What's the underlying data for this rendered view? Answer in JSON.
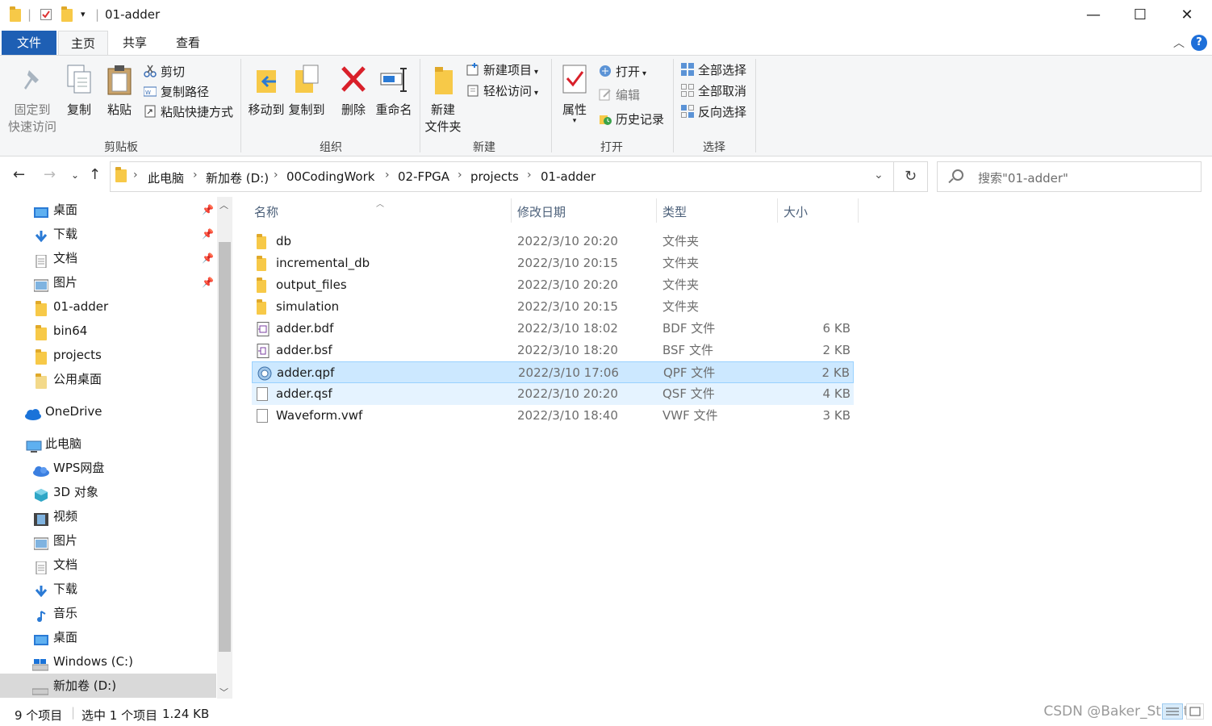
{
  "window": {
    "title": "01-adder",
    "minimize": "—",
    "maximize": "☐",
    "close": "✕"
  },
  "tabs": {
    "file": "文件",
    "home": "主页",
    "share": "共享",
    "view": "查看"
  },
  "ribbon": {
    "clipboard": {
      "group": "剪贴板",
      "pin_line1": "固定到",
      "pin_line2": "快速访问",
      "copy": "复制",
      "paste": "粘贴",
      "cut": "剪切",
      "copy_path": "复制路径",
      "paste_shortcut": "粘贴快捷方式"
    },
    "organize": {
      "group": "组织",
      "move_to": "移动到",
      "copy_to": "复制到",
      "delete": "删除",
      "rename": "重命名"
    },
    "new": {
      "group": "新建",
      "new_folder_line1": "新建",
      "new_folder_line2": "文件夹",
      "new_item": "新建项目",
      "easy_access": "轻松访问"
    },
    "open": {
      "group": "打开",
      "properties": "属性",
      "open": "打开",
      "edit": "编辑",
      "history": "历史记录"
    },
    "select": {
      "group": "选择",
      "select_all": "全部选择",
      "select_none": "全部取消",
      "invert": "反向选择"
    }
  },
  "address": {
    "crumbs": [
      "此电脑",
      "新加卷 (D:)",
      "00CodingWork",
      "02-FPGA",
      "projects",
      "01-adder"
    ],
    "search_placeholder": "搜索\"01-adder\""
  },
  "nav": {
    "items": [
      {
        "label": "桌面",
        "icon": "desktop-icon",
        "pinned": true
      },
      {
        "label": "下载",
        "icon": "download-icon",
        "pinned": true
      },
      {
        "label": "文档",
        "icon": "document-icon",
        "pinned": true
      },
      {
        "label": "图片",
        "icon": "picture-icon",
        "pinned": true
      },
      {
        "label": "01-adder",
        "icon": "folder-icon"
      },
      {
        "label": "bin64",
        "icon": "folder-icon"
      },
      {
        "label": "projects",
        "icon": "folder-icon"
      },
      {
        "label": "公用桌面",
        "icon": "folder-icon"
      },
      {
        "label": "OneDrive",
        "icon": "cloud-icon"
      },
      {
        "label": "此电脑",
        "icon": "computer-icon"
      },
      {
        "label": "WPS网盘",
        "icon": "cloud-icon"
      },
      {
        "label": "3D 对象",
        "icon": "cube-icon"
      },
      {
        "label": "视频",
        "icon": "video-icon"
      },
      {
        "label": "图片",
        "icon": "picture-icon"
      },
      {
        "label": "文档",
        "icon": "document-icon"
      },
      {
        "label": "下载",
        "icon": "download-icon"
      },
      {
        "label": "音乐",
        "icon": "music-icon"
      },
      {
        "label": "桌面",
        "icon": "desktop-icon"
      },
      {
        "label": "Windows (C:)",
        "icon": "drive-icon"
      },
      {
        "label": "新加卷 (D:)",
        "icon": "drive-icon",
        "selected": true
      }
    ]
  },
  "columns": {
    "name": "名称",
    "date": "修改日期",
    "type": "类型",
    "size": "大小"
  },
  "files": [
    {
      "name": "db",
      "date": "2022/3/10 20:20",
      "type": "文件夹",
      "size": "",
      "icon": "folder-icon"
    },
    {
      "name": "incremental_db",
      "date": "2022/3/10 20:15",
      "type": "文件夹",
      "size": "",
      "icon": "folder-icon"
    },
    {
      "name": "output_files",
      "date": "2022/3/10 20:20",
      "type": "文件夹",
      "size": "",
      "icon": "folder-icon"
    },
    {
      "name": "simulation",
      "date": "2022/3/10 20:15",
      "type": "文件夹",
      "size": "",
      "icon": "folder-icon"
    },
    {
      "name": "adder.bdf",
      "date": "2022/3/10 18:02",
      "type": "BDF 文件",
      "size": "6 KB",
      "icon": "bdf-file-icon"
    },
    {
      "name": "adder.bsf",
      "date": "2022/3/10 18:20",
      "type": "BSF 文件",
      "size": "2 KB",
      "icon": "bsf-file-icon"
    },
    {
      "name": "adder.qpf",
      "date": "2022/3/10 17:06",
      "type": "QPF 文件",
      "size": "2 KB",
      "icon": "qpf-file-icon",
      "selected": true
    },
    {
      "name": "adder.qsf",
      "date": "2022/3/10 20:20",
      "type": "QSF 文件",
      "size": "4 KB",
      "icon": "file-icon",
      "hover": true
    },
    {
      "name": "Waveform.vwf",
      "date": "2022/3/10 18:40",
      "type": "VWF 文件",
      "size": "3 KB",
      "icon": "file-icon"
    }
  ],
  "status": {
    "count": "9 个项目",
    "selection": "选中 1 个项目",
    "size": "1.24 KB"
  },
  "watermark": "CSDN @Baker_Streets"
}
